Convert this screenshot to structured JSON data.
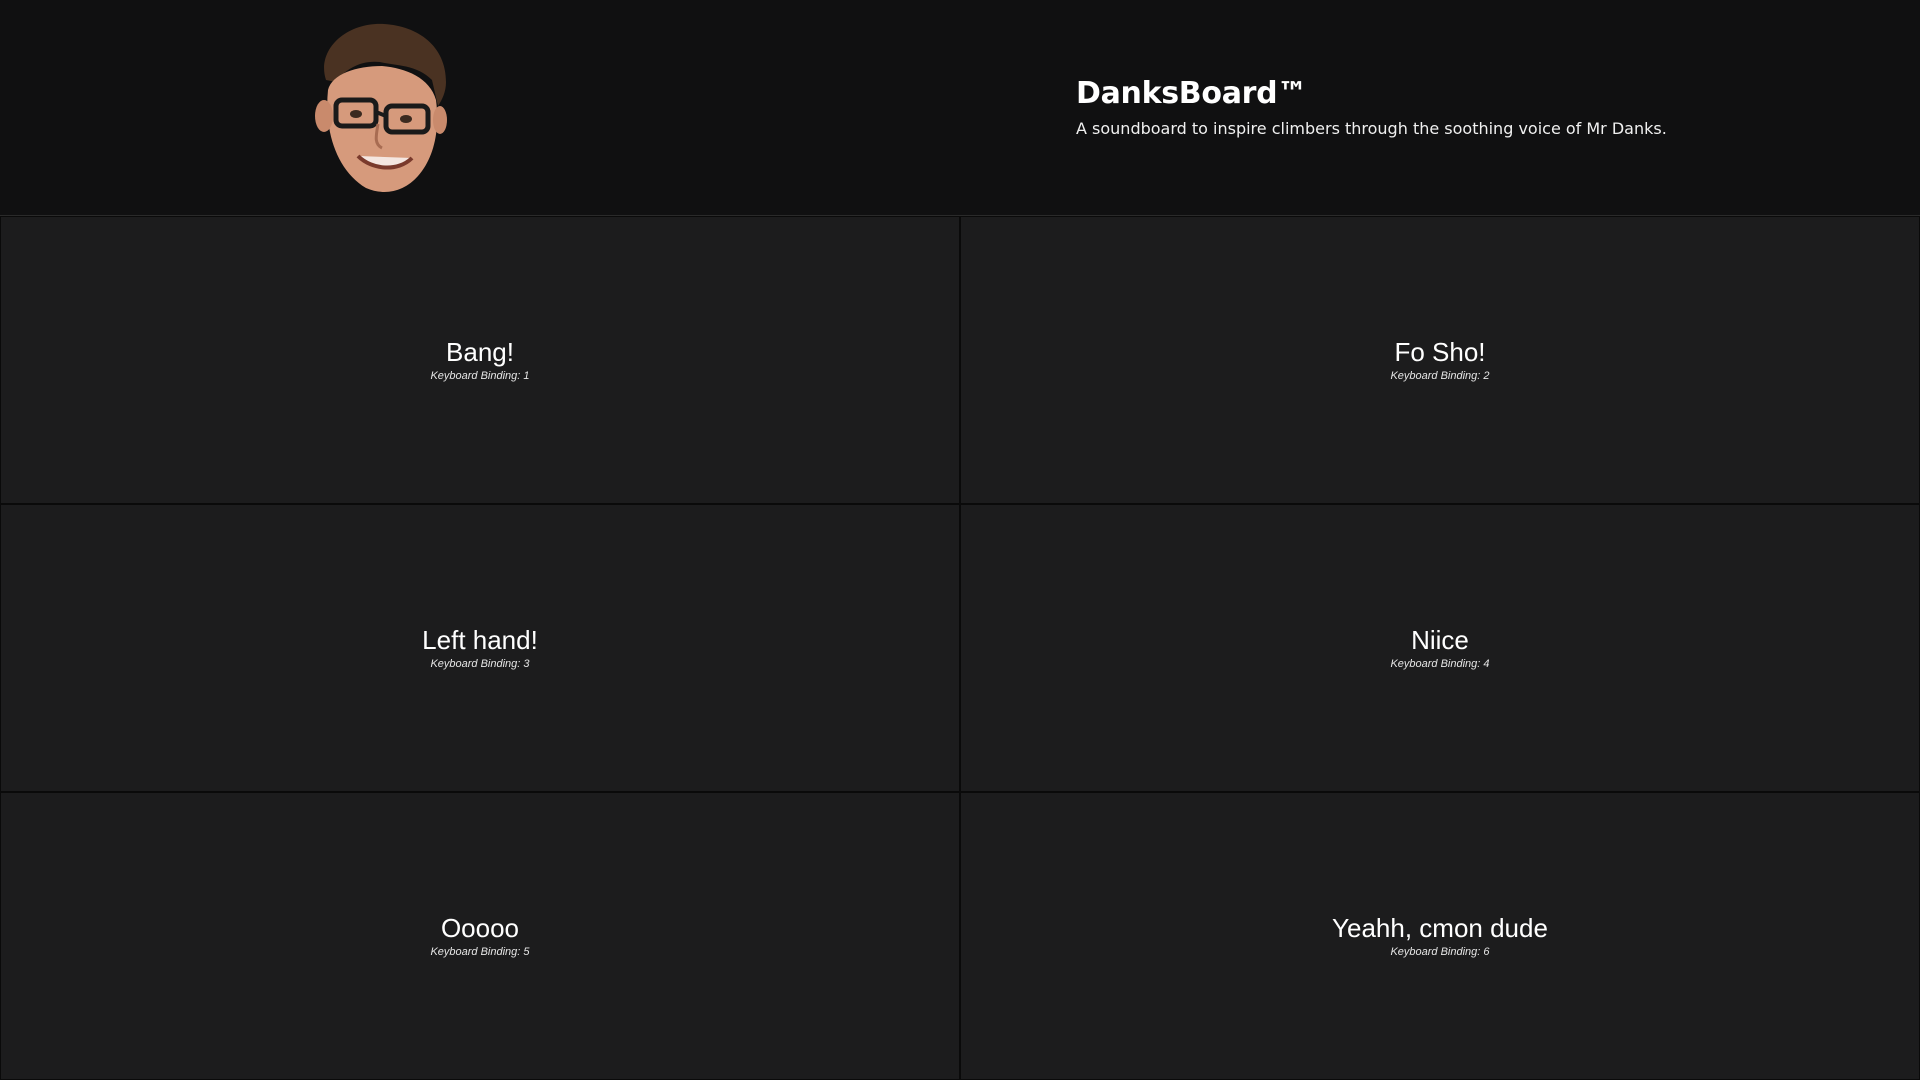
{
  "header": {
    "title": "DanksBoard™",
    "subtitle": "A soundboard to inspire climbers through the soothing voice of Mr Danks.",
    "avatar_icon": "face-photo-icon"
  },
  "sounds": [
    {
      "label": "Bang!",
      "binding": "Keyboard Binding: 1"
    },
    {
      "label": "Fo Sho!",
      "binding": "Keyboard Binding: 2"
    },
    {
      "label": "Left hand!",
      "binding": "Keyboard Binding: 3"
    },
    {
      "label": "Niice",
      "binding": "Keyboard Binding: 4"
    },
    {
      "label": "Ooooo",
      "binding": "Keyboard Binding: 5"
    },
    {
      "label": "Yeahh, cmon dude",
      "binding": "Keyboard Binding: 6"
    }
  ],
  "colors": {
    "background": "#0f0f10",
    "tile": "#1c1c1d",
    "text": "#ffffff"
  }
}
